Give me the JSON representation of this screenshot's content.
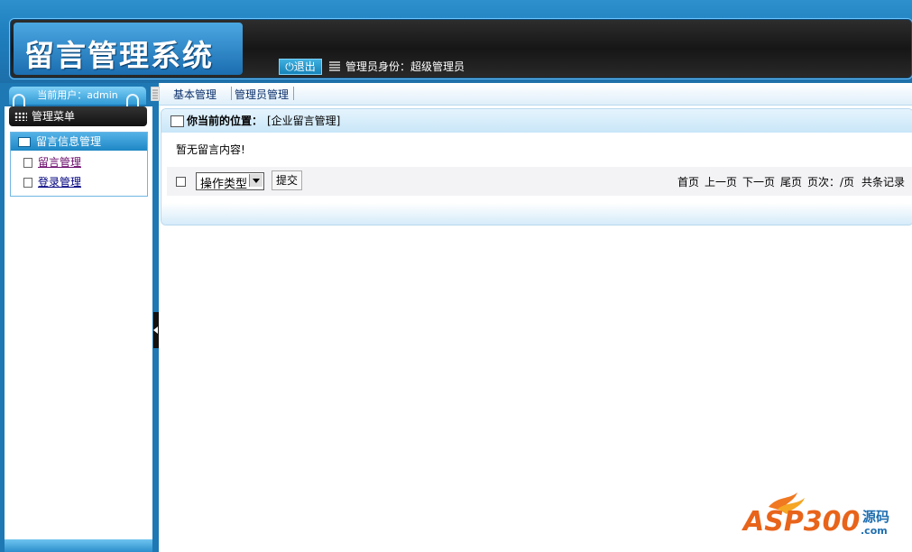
{
  "header": {
    "title": "留言管理系统",
    "logout_label": "退出",
    "role_text": "管理员身份：超级管理员"
  },
  "sidebar": {
    "current_user": "当前用户：admin",
    "menu_title": "管理菜单",
    "group_title": "留言信息管理",
    "items": [
      {
        "label": "留言管理"
      },
      {
        "label": "登录管理"
      }
    ]
  },
  "tabs": [
    {
      "label": "基本管理"
    },
    {
      "label": "管理员管理"
    }
  ],
  "main": {
    "location_label": "你当前的位置：",
    "location_value": "[企业留言管理]",
    "empty_message": "暂无留言内容!",
    "action_select_value": "操作类型",
    "submit_label": "提交",
    "pager": {
      "first": "首页",
      "prev": "上一页",
      "next": "下一页",
      "last": "尾页",
      "page_info": "页次：/页",
      "total": "共条记录"
    }
  },
  "watermark": {
    "brand": "ASP300",
    "cn": "源码",
    "domain": ".com"
  },
  "colors": {
    "header_blue": "#1f7fbf",
    "header_dark": "#161616",
    "sidebar_blue": "#1d78b4",
    "link": "#000080"
  }
}
